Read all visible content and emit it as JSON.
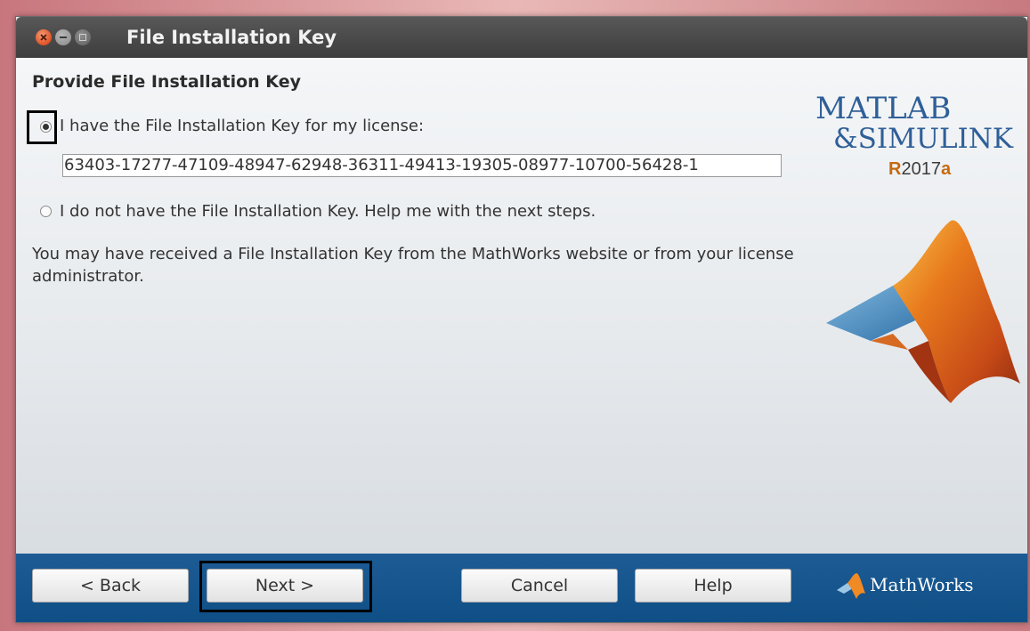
{
  "window": {
    "title": "File Installation Key"
  },
  "page": {
    "heading": "Provide File Installation Key",
    "option_have_key": "I have the File Installation Key for my license:",
    "key_value": "63403-17277-47109-48947-62948-36311-49413-19305-08977-10700-56428-1",
    "option_no_key": "I do not have the File Installation Key.  Help me with the next steps.",
    "description": "You may have received a File Installation Key from the MathWorks website or from your license administrator."
  },
  "logo": {
    "matlab": "MATLAB",
    "simulink": "&SIMULINK",
    "release_prefix": "R",
    "release_year": "2017",
    "release_suffix": "a"
  },
  "footer": {
    "back": "< Back",
    "next": "Next >",
    "cancel": "Cancel",
    "help": "Help",
    "brand": "MathWorks"
  },
  "colors": {
    "footer_blue": "#155487",
    "logo_blue": "#2f5f98",
    "accent_orange": "#c56a10"
  }
}
